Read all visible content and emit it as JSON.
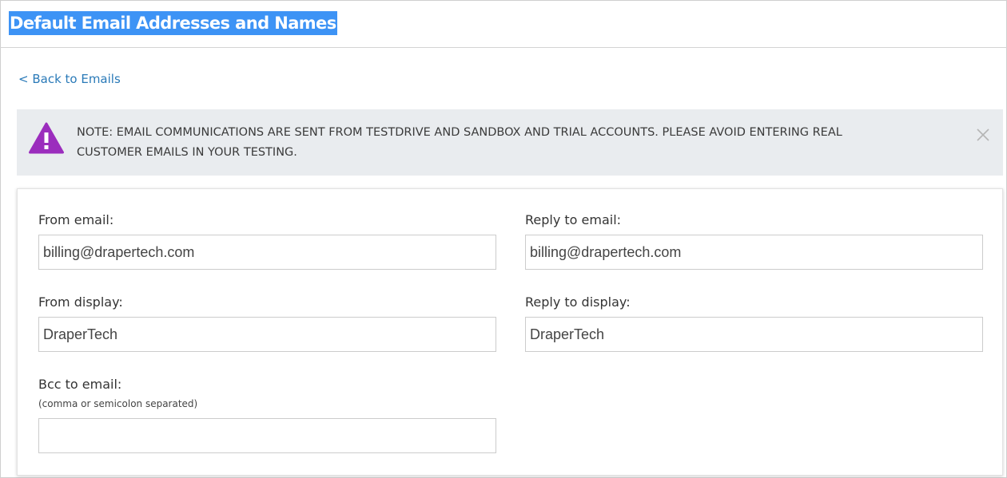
{
  "page": {
    "title": "Default Email Addresses and Names",
    "back_link": "< Back to Emails"
  },
  "notice": {
    "icon": "warning-triangle-icon",
    "text": "NOTE: EMAIL COMMUNICATIONS ARE SENT FROM TESTDRIVE AND SANDBOX AND TRIAL ACCOUNTS. PLEASE AVOID ENTERING REAL CUSTOMER EMAILS IN YOUR TESTING.",
    "close_icon": "close-icon",
    "icon_color": "#9b2dbd"
  },
  "form": {
    "from_email": {
      "label": "From email:",
      "value": "billing@drapertech.com"
    },
    "reply_to_email": {
      "label": "Reply to email:",
      "value": "billing@drapertech.com"
    },
    "from_display": {
      "label": "From display:",
      "value": "DraperTech"
    },
    "reply_to_display": {
      "label": "Reply to display:",
      "value": "DraperTech"
    },
    "bcc_email": {
      "label": "Bcc to email:",
      "hint": "(comma or semicolon separated)",
      "value": ""
    }
  },
  "colors": {
    "title_highlight": "#3d93f5",
    "link": "#2a7ab8",
    "notice_bg": "#e9ecef"
  }
}
